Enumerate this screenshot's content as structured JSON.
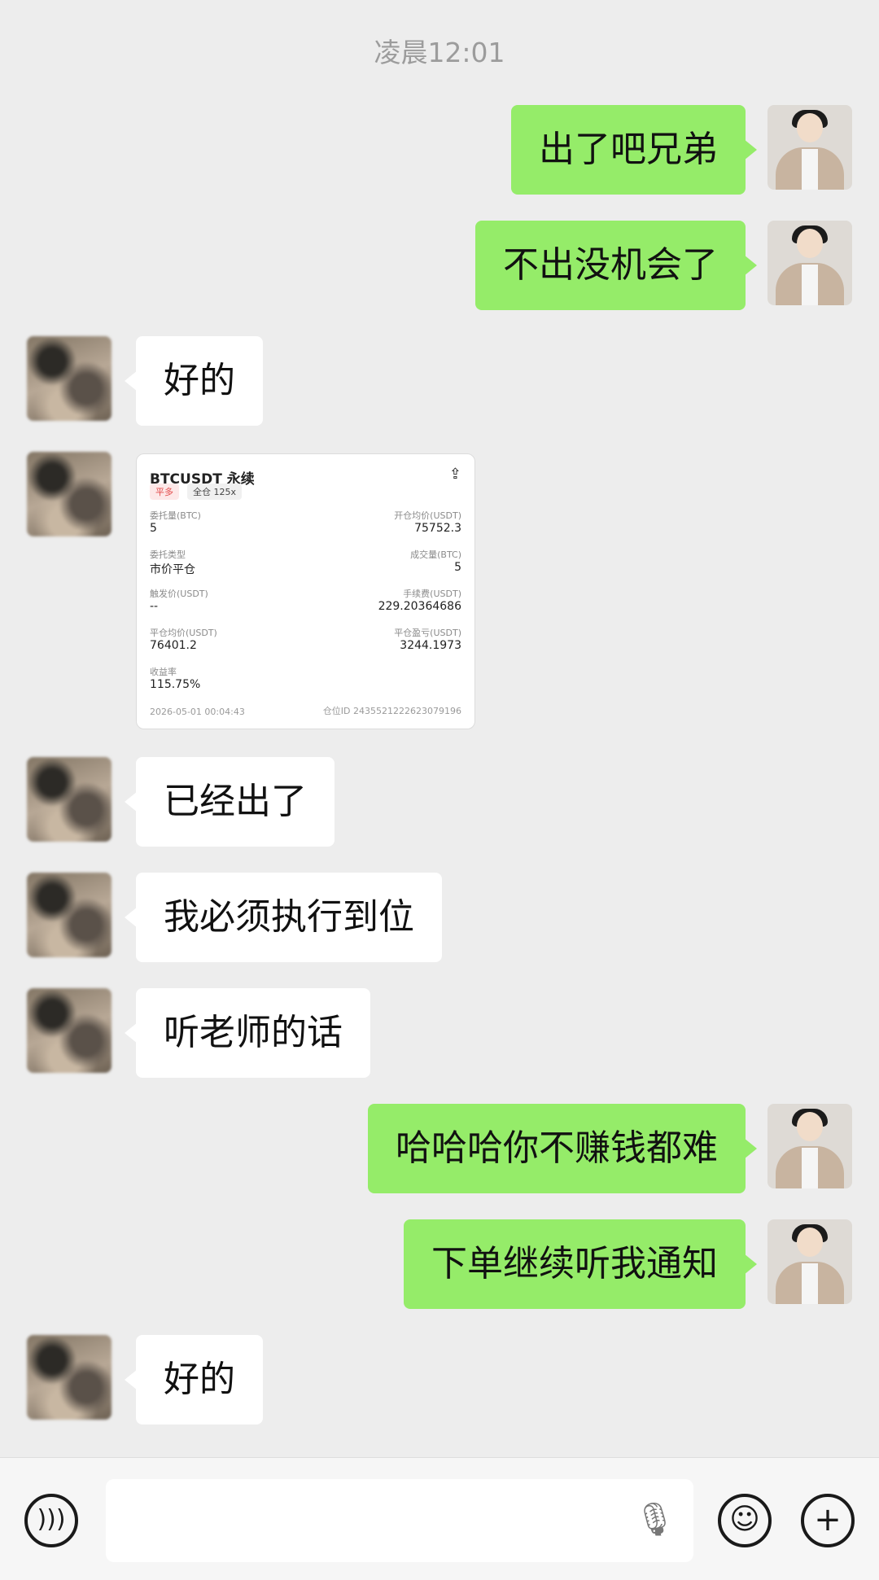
{
  "timestamp": "凌晨12:01",
  "messages": [
    {
      "side": "right",
      "text": "出了吧兄弟"
    },
    {
      "side": "right",
      "text": "不出没机会了"
    },
    {
      "side": "left",
      "text": "好的"
    },
    {
      "side": "left",
      "type": "order_card"
    },
    {
      "side": "left",
      "text": "已经出了"
    },
    {
      "side": "left",
      "text": "我必须执行到位"
    },
    {
      "side": "left",
      "text": "听老师的话"
    },
    {
      "side": "right",
      "text": "哈哈哈你不赚钱都难"
    },
    {
      "side": "right",
      "text": "下单继续听我通知"
    },
    {
      "side": "left",
      "text": "好的"
    }
  ],
  "order_card": {
    "title": "BTCUSDT 永续",
    "share_icon": "share-icon",
    "tag_side": "平多",
    "tag_margin": "全仓 125x",
    "order_qty_label": "委托量(BTC)",
    "order_qty": "5",
    "open_avg_label": "开仓均价(USDT)",
    "open_avg": "75752.3",
    "order_type_label": "委托类型",
    "order_type": "市价平仓",
    "filled_label": "成交量(BTC)",
    "filled": "5",
    "trigger_label": "触发价(USDT)",
    "trigger": "--",
    "fee_label": "手续费(USDT)",
    "fee": "229.20364686",
    "close_avg_label": "平仓均价(USDT)",
    "close_avg": "76401.2",
    "pnl_label": "平仓盈亏(USDT)",
    "pnl": "3244.1973",
    "roi_label": "收益率",
    "roi": "115.75%",
    "datetime": "2026-05-01 00:04:43",
    "position_id": "仓位ID 2435521222623079196"
  },
  "bottom_bar": {
    "voice_icon": "voice-icon",
    "mic_icon": "mic-icon",
    "emoji_icon": "emoji-icon",
    "plus_icon": "plus-icon"
  },
  "colors": {
    "background": "#ededed",
    "self_bubble": "#95ec69",
    "other_bubble": "#ffffff"
  }
}
